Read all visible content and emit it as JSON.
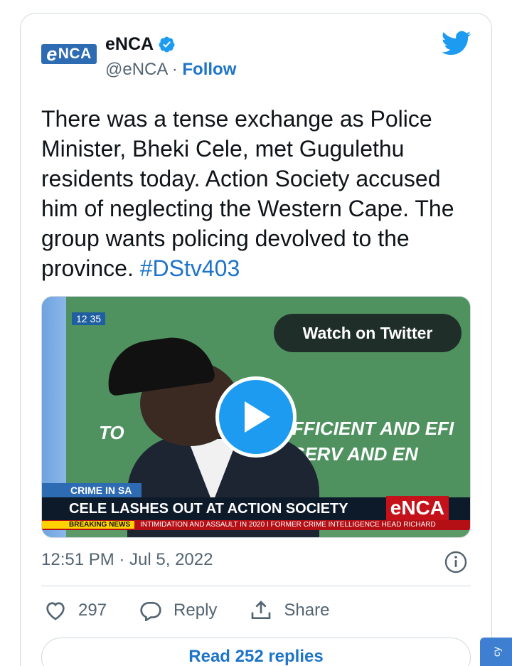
{
  "header": {
    "logo_text": "NCA",
    "logo_letter": "e",
    "display_name": "eNCA",
    "handle": "@eNCA",
    "separator": " · ",
    "follow_label": "Follow"
  },
  "tweet": {
    "text": "There was a tense exchange as Police Minister, Bheki Cele, met Gugulethu residents today. Action Society accused him of neglecting the Western Cape. The group wants policing devolved to the province. ",
    "hashtag": "#DStv403"
  },
  "media": {
    "watch_label": "Watch on Twitter",
    "clip_time": "12 35",
    "bg_text_left": "TO",
    "bg_text_right1": "FFICIENT AND EFI",
    "bg_text_right2": "SERV    AND EN",
    "category": "CRIME IN SA",
    "headline": "CELE LASHES OUT AT ACTION SOCIETY",
    "channel_logo": "eNCA",
    "ticker_tag": "BREAKING NEWS",
    "ticker_text": "INTIMIDATION AND ASSAULT IN 2020  I  FORMER CRIME INTELLIGENCE HEAD RICHARD"
  },
  "meta": {
    "timestamp": "12:51 PM · Jul 5, 2022"
  },
  "actions": {
    "likes": "297",
    "reply_label": "Reply",
    "share_label": "Share"
  },
  "footer": {
    "read_replies_label": "Read 252 replies",
    "side_tab_text": "cy"
  },
  "colors": {
    "brand_blue": "#1d74c8",
    "twitter_blue": "#1d9bf0",
    "border": "#cfd9de",
    "muted": "#536471"
  }
}
